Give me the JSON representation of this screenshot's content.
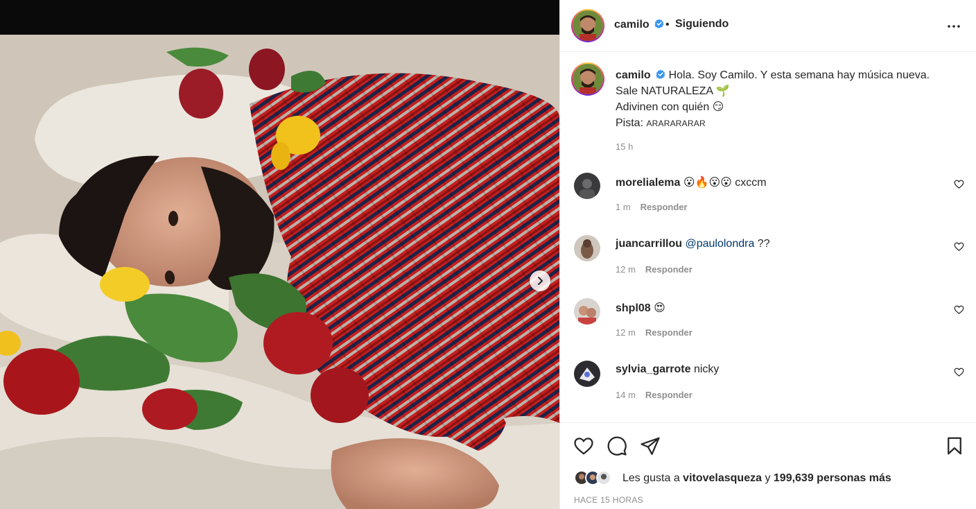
{
  "post": {
    "author": {
      "username": "camilo",
      "verified": true,
      "follow_status": "Siguiendo",
      "avatar": "profile-photo"
    },
    "caption": {
      "username": "camilo",
      "line1": "Hola. Soy Camilo. Y esta semana hay música nueva.",
      "line2": "Sale NATURALEZA 🌱",
      "line3": "Adivinen con quién 😏",
      "line4_prefix": "Pista: ",
      "line4_hint": "ARARARARAR",
      "time": "15 h"
    },
    "comments": [
      {
        "username": "morelialema",
        "text": "😮🔥😮😮 cxccm",
        "time": "1 m",
        "reply": "Responder"
      },
      {
        "username": "juancarrillou",
        "mention": "@paulolondra",
        "text": " ??",
        "time": "12 m",
        "reply": "Responder"
      },
      {
        "username": "shpl08",
        "text": "😍",
        "time": "12 m",
        "reply": "Responder"
      },
      {
        "username": "sylvia_garrote",
        "text": "nicky",
        "time": "14 m",
        "reply": "Responder"
      }
    ],
    "likes": {
      "prefix": "Les gusta a ",
      "first_user": "vitovelasqueza",
      "middle": " y ",
      "others": "199,639 personas más"
    },
    "posted_ago": "HACE 15 HORAS"
  },
  "icons": {
    "more": "more-options-icon",
    "like": "heart-icon",
    "comment": "comment-icon",
    "share": "share-icon",
    "save": "bookmark-icon",
    "next": "chevron-right-icon"
  },
  "colors": {
    "verified": "#3897f0",
    "text": "#262626",
    "muted": "#8e8e8e",
    "mention": "#00376b"
  }
}
